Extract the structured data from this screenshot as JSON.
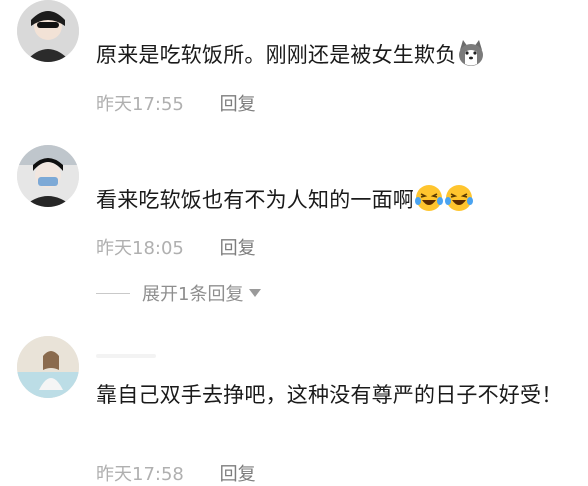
{
  "comments": [
    {
      "text": "原来是吃软饭所。刚刚还是被女生欺负",
      "emoji": [
        "husky-face-emoji"
      ],
      "time": "昨天17:55",
      "reply_label": "回复"
    },
    {
      "text": "看来吃软饭也有不为人知的一面啊",
      "emoji": [
        "laughing-crying-emoji",
        "laughing-crying-emoji"
      ],
      "time": "昨天18:05",
      "reply_label": "回复",
      "expand_label": "展开1条回复"
    },
    {
      "text": "靠自己双手去挣吧，这种没有尊严的日子不好受！",
      "time": "昨天17:58",
      "reply_label": "回复"
    }
  ],
  "colors": {
    "text": "#1a1a1a",
    "meta": "#b0b0b0",
    "reply": "#7d7d7d",
    "emoji_yellow": "#ffc52e"
  }
}
